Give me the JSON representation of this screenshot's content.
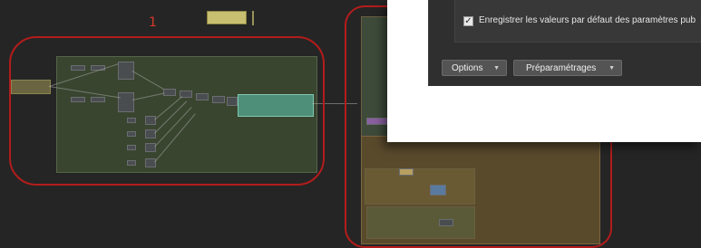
{
  "dialog": {
    "checkbox_label": "Enregistrer les valeurs par défaut des paramètres pub",
    "checkbox_checked": "✓",
    "options_button": "Options",
    "presets_button": "Préparamétrages"
  },
  "graph": {
    "callout_1": "1"
  }
}
